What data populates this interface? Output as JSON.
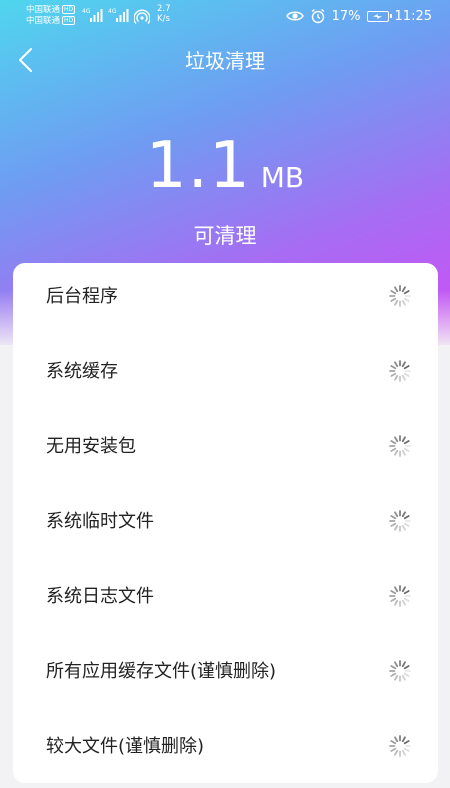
{
  "status_bar": {
    "carrier1": "中国联通",
    "carrier2": "中国联通",
    "hd": "HD",
    "net1": "4G",
    "net2": "4G",
    "speed_value": "2.7",
    "speed_unit": "K/s",
    "battery": "17%",
    "time": "11:25"
  },
  "header": {
    "title": "垃圾清理"
  },
  "summary": {
    "size_value": "1.1",
    "size_unit": "MB",
    "caption": "可清理"
  },
  "items": [
    {
      "label": "后台程序"
    },
    {
      "label": "系统缓存"
    },
    {
      "label": "无用安装包"
    },
    {
      "label": "系统临时文件"
    },
    {
      "label": "系统日志文件"
    },
    {
      "label": "所有应用缓存文件(谨慎删除)"
    },
    {
      "label": "较大文件(谨慎删除)"
    }
  ]
}
